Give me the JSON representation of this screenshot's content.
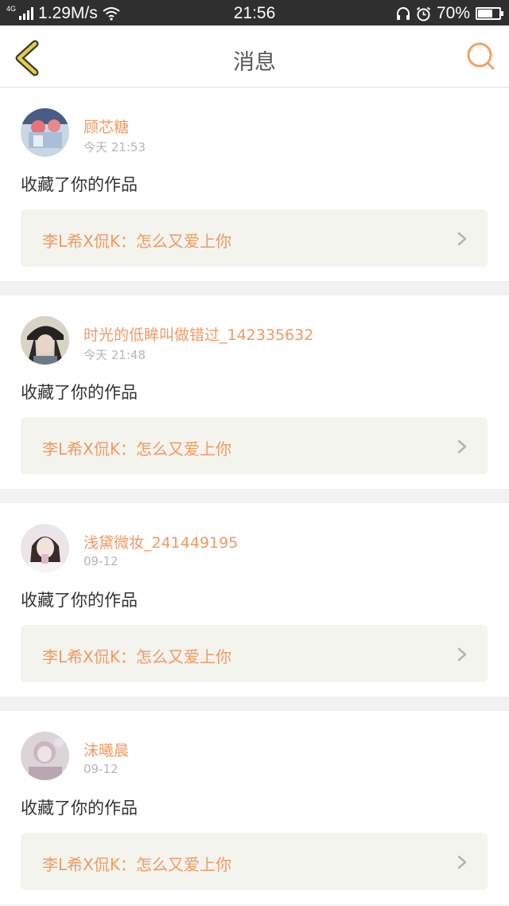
{
  "status_bar": {
    "network_type": "4G",
    "speed": "1.29M/s",
    "time": "21:56",
    "battery": "70%",
    "battery_level": 0.7,
    "icons": [
      "signal-icon",
      "wifi-icon",
      "headphones-icon",
      "alarm-icon",
      "battery-icon"
    ]
  },
  "header": {
    "title": "消息",
    "back_icon": "back-chevron-icon",
    "search_icon": "search-icon"
  },
  "colors": {
    "accent": "#ef9a63",
    "back_icon": "#e6cf3b",
    "status_bar_bg": "#2f2f2f"
  },
  "messages": [
    {
      "name": "顾芯糖",
      "time": "今天 21:53",
      "action": "收藏了你的作品",
      "work": "李L希X侃K：怎么又爱上你"
    },
    {
      "name": "时光的低眸叫做错过_142335632",
      "time": "今天 21:48",
      "action": "收藏了你的作品",
      "work": "李L希X侃K：怎么又爱上你"
    },
    {
      "name": "浅黛微妆_241449195",
      "time": "09-12",
      "action": "收藏了你的作品",
      "work": "李L希X侃K：怎么又爱上你"
    },
    {
      "name": "沫曦晨",
      "time": "09-12",
      "action": "收藏了你的作品",
      "work": "李L希X侃K：怎么又爱上你"
    }
  ]
}
